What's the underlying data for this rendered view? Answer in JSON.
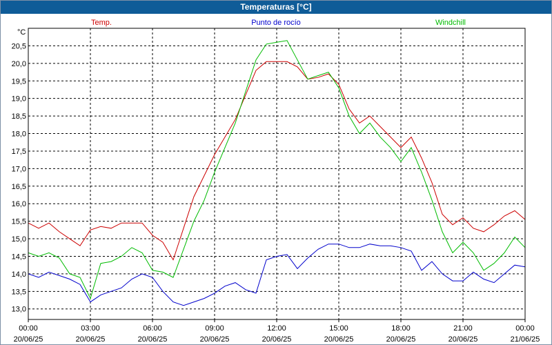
{
  "window": {
    "title": "Temperaturas [°C]"
  },
  "chart_data": {
    "type": "line",
    "title": "Temperaturas [°C]",
    "ylabel": "°C",
    "ylim": [
      12.7,
      21.0
    ],
    "xlim": [
      "2025-06-20T00:00",
      "2025-06-21T00:00"
    ],
    "grid": true,
    "legend_placement": "top",
    "y_ticks": [
      "13,0",
      "13,5",
      "14,0",
      "14,5",
      "15,0",
      "15,5",
      "16,0",
      "16,5",
      "17,0",
      "17,5",
      "18,0",
      "18,5",
      "19,0",
      "19,5",
      "20,0",
      "20,5"
    ],
    "y_tick_values": [
      13.0,
      13.5,
      14.0,
      14.5,
      15.0,
      15.5,
      16.0,
      16.5,
      17.0,
      17.5,
      18.0,
      18.5,
      19.0,
      19.5,
      20.0,
      20.5
    ],
    "x_ticks": [
      {
        "time": "00:00",
        "date": "20/06/25",
        "hour": 0
      },
      {
        "time": "03:00",
        "date": "20/06/25",
        "hour": 3
      },
      {
        "time": "06:00",
        "date": "20/06/25",
        "hour": 6
      },
      {
        "time": "09:00",
        "date": "20/06/25",
        "hour": 9
      },
      {
        "time": "12:00",
        "date": "20/06/25",
        "hour": 12
      },
      {
        "time": "15:00",
        "date": "20/06/25",
        "hour": 15
      },
      {
        "time": "18:00",
        "date": "20/06/25",
        "hour": 18
      },
      {
        "time": "21:00",
        "date": "20/06/25",
        "hour": 21
      },
      {
        "time": "00:00",
        "date": "21/06/25",
        "hour": 24
      }
    ],
    "hours": [
      0,
      0.5,
      1,
      1.5,
      2,
      2.5,
      3,
      3.5,
      4,
      4.5,
      5,
      5.5,
      6,
      6.5,
      7,
      7.5,
      8,
      8.5,
      9,
      9.5,
      10,
      10.5,
      11,
      11.5,
      12,
      12.5,
      13,
      13.5,
      14,
      14.5,
      15,
      15.5,
      16,
      16.5,
      17,
      17.5,
      18,
      18.5,
      19,
      19.5,
      20,
      20.5,
      21,
      21.5,
      22,
      22.5,
      23,
      23.5,
      24
    ],
    "series": [
      {
        "name": "Temp.",
        "color": "#cc0000",
        "values": [
          15.45,
          15.3,
          15.45,
          15.2,
          15.0,
          14.8,
          15.25,
          15.35,
          15.3,
          15.45,
          15.45,
          15.45,
          15.1,
          14.9,
          14.4,
          15.3,
          16.2,
          16.8,
          17.4,
          17.9,
          18.4,
          19.1,
          19.8,
          20.05,
          20.05,
          20.05,
          19.9,
          19.55,
          19.6,
          19.7,
          19.4,
          18.7,
          18.3,
          18.5,
          18.2,
          17.9,
          17.6,
          17.9,
          17.3,
          16.6,
          15.7,
          15.4,
          15.6,
          15.3,
          15.2,
          15.4,
          15.65,
          15.8,
          15.55
        ]
      },
      {
        "name": "Punto de rocío",
        "color": "#0000cc",
        "values": [
          14.0,
          13.9,
          14.05,
          13.95,
          13.85,
          13.7,
          13.2,
          13.4,
          13.5,
          13.6,
          13.85,
          14.0,
          13.9,
          13.5,
          13.2,
          13.1,
          13.2,
          13.3,
          13.45,
          13.65,
          13.75,
          13.55,
          13.45,
          14.4,
          14.5,
          14.55,
          14.15,
          14.45,
          14.7,
          14.85,
          14.85,
          14.75,
          14.75,
          14.85,
          14.8,
          14.8,
          14.75,
          14.65,
          14.1,
          14.35,
          14.0,
          13.8,
          13.8,
          14.05,
          13.85,
          13.75,
          14.0,
          14.25,
          14.2
        ]
      },
      {
        "name": "Windchill",
        "color": "#00bb00",
        "values": [
          14.6,
          14.5,
          14.6,
          14.45,
          14.0,
          13.9,
          13.3,
          14.3,
          14.35,
          14.5,
          14.75,
          14.6,
          14.1,
          14.05,
          13.9,
          14.7,
          15.5,
          16.1,
          16.9,
          17.6,
          18.3,
          19.2,
          20.1,
          20.55,
          20.6,
          20.65,
          20.1,
          19.55,
          19.65,
          19.75,
          19.3,
          18.5,
          18.0,
          18.3,
          17.9,
          17.6,
          17.2,
          17.6,
          16.9,
          16.1,
          15.2,
          14.6,
          14.9,
          14.6,
          14.1,
          14.3,
          14.6,
          15.05,
          14.75
        ]
      }
    ]
  }
}
